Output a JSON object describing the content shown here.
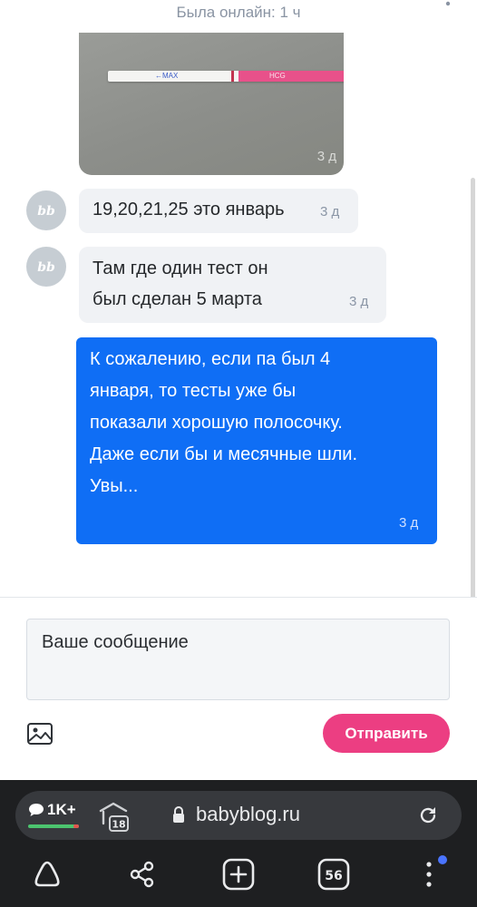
{
  "header": {
    "status": "Была онлайн: 1 ч"
  },
  "chat": {
    "photo": {
      "time": "3 д",
      "strip_control": "←MAX",
      "strip_brand": "HCG"
    },
    "messages": [
      {
        "author": "incoming",
        "avatar": "bb",
        "text": "19,20,21,25 это январь",
        "time": "3 д"
      },
      {
        "author": "incoming",
        "avatar": "bb",
        "lines": [
          "Там где один тест он",
          "был сделан 5 марта"
        ],
        "time": "3 д"
      },
      {
        "author": "outgoing",
        "lines": [
          "К сожалению, если па был 4",
          "января, то тесты уже бы",
          "показали хорошую полосочку.",
          "Даже если бы и месячные шли.",
          "Увы..."
        ],
        "time": "3 д"
      }
    ]
  },
  "composer": {
    "placeholder": "Ваше сообщение",
    "send_label": "Отправить",
    "attach_icon": "image-icon"
  },
  "browser": {
    "comments_count": "1K+",
    "age_badge": "18",
    "url": "babyblog.ru",
    "tabs_count": "56",
    "icons": [
      "back-icon",
      "more-icon",
      "lock-icon",
      "reload-icon",
      "home-icon",
      "share-icon",
      "new-tab-icon",
      "tabs-icon",
      "menu-icon"
    ]
  },
  "colors": {
    "outgoing": "#0f6ef5",
    "incoming": "#f0f2f5",
    "send": "#ec3e82",
    "browser_bar": "#1e1f21"
  }
}
